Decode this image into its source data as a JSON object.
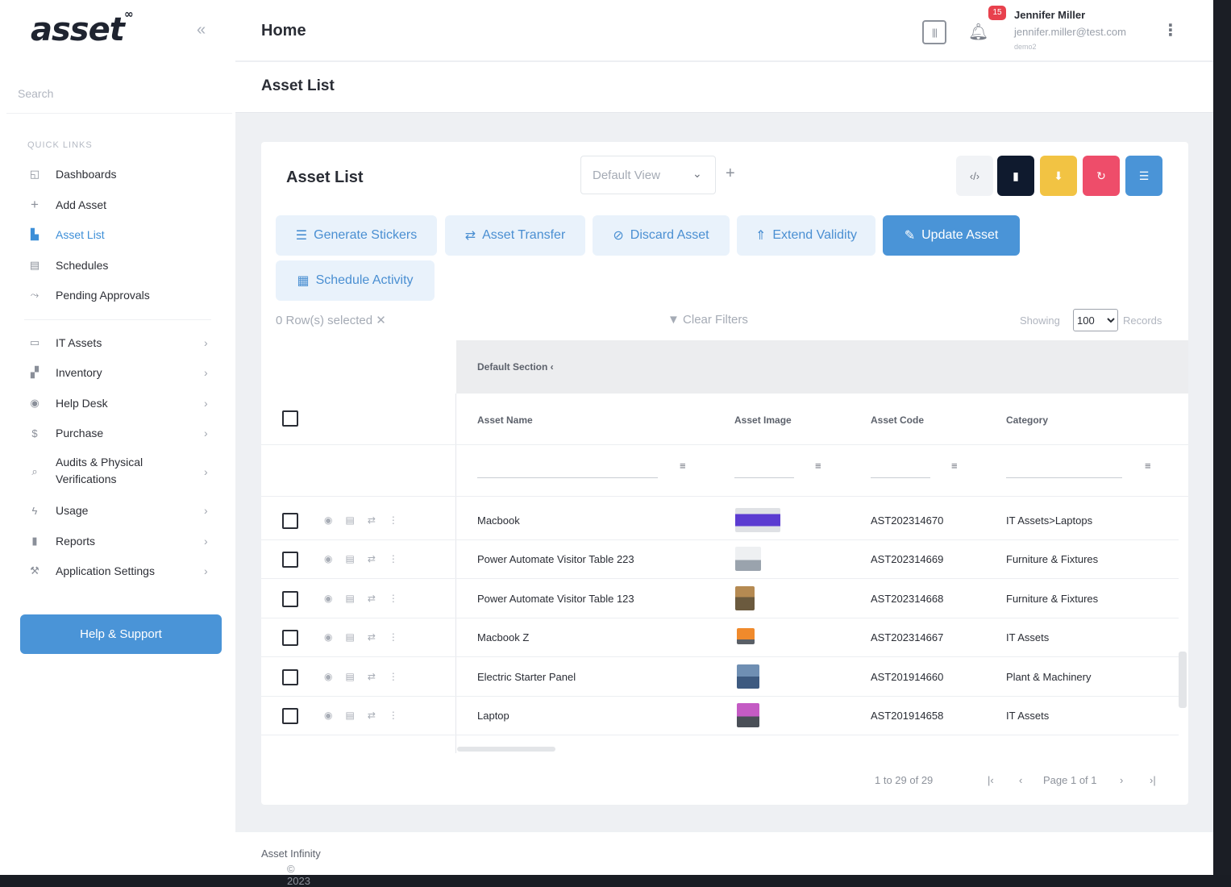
{
  "app": {
    "logo": "asset",
    "logo_sup": "∞"
  },
  "sidebar": {
    "search_placeholder": "Search",
    "quick_links_label": "QUICK LINKS",
    "quick_links": [
      {
        "label": "Dashboards",
        "icon": "dashboard-icon"
      },
      {
        "label": "Add Asset",
        "icon": "plus-icon"
      },
      {
        "label": "Asset List",
        "icon": "list-icon",
        "active": true
      },
      {
        "label": "Schedules",
        "icon": "calendar-icon"
      },
      {
        "label": "Pending Approvals",
        "icon": "approval-icon"
      }
    ],
    "modules": [
      {
        "label": "IT Assets",
        "icon": "laptop-icon"
      },
      {
        "label": "Inventory",
        "icon": "boxes-icon"
      },
      {
        "label": "Help Desk",
        "icon": "help-icon"
      },
      {
        "label": "Purchase",
        "icon": "dollar-icon"
      },
      {
        "label": "Audits & Physical",
        "label2": "Verifications",
        "icon": "audit-icon"
      },
      {
        "label": "Usage",
        "icon": "usage-icon"
      },
      {
        "label": "Reports",
        "icon": "report-icon"
      },
      {
        "label": "Application Settings",
        "icon": "wrench-icon"
      }
    ],
    "help_button": "Help & Support"
  },
  "topbar": {
    "title": "Home",
    "notification_count": "15",
    "user_name": "Jennifer Miller",
    "user_email": "jennifer.miller@test.com",
    "user_sub": "demo2"
  },
  "subbar": {
    "title": "Asset List"
  },
  "card": {
    "title": "Asset List",
    "view_select": "Default View",
    "actions": [
      "Generate Stickers",
      "Asset Transfer",
      "Discard Asset",
      "Extend Validity",
      "Update Asset",
      "Schedule Activity"
    ],
    "selected_info": "0 Row(s) selected ✕",
    "clear_filters": "Clear Filters",
    "showing_label": "Showing",
    "page_size": "100",
    "records_label": "Records"
  },
  "colors": {
    "accent": "#4a94d7",
    "dark": "#0f1a2e",
    "yellow": "#f2c343",
    "red": "#ee4d6a",
    "blue": "#4a94d7"
  },
  "grid": {
    "section": "Default Section  ‹",
    "columns": [
      "Asset Name",
      "Asset Image",
      "Asset Code",
      "Category"
    ],
    "rows": [
      {
        "name": "Macbook",
        "code": "AST202314670",
        "category": "IT Assets>Laptops"
      },
      {
        "name": "Power Automate Visitor Table 223",
        "code": "AST202314669",
        "category": "Furniture & Fixtures"
      },
      {
        "name": "Power Automate Visitor Table 123",
        "code": "AST202314668",
        "category": "Furniture & Fixtures"
      },
      {
        "name": "Macbook Z",
        "code": "AST202314667",
        "category": "IT Assets"
      },
      {
        "name": "Electric Starter Panel",
        "code": "AST201914660",
        "category": "Plant & Machinery"
      },
      {
        "name": "Laptop",
        "code": "AST201914658",
        "category": "IT Assets"
      }
    ]
  },
  "pagination": {
    "range": "1 to 29 of 29",
    "page": "Page 1 of 1"
  },
  "footer": {
    "copyright": "© 2023",
    "brand": "Asset Infinity"
  }
}
